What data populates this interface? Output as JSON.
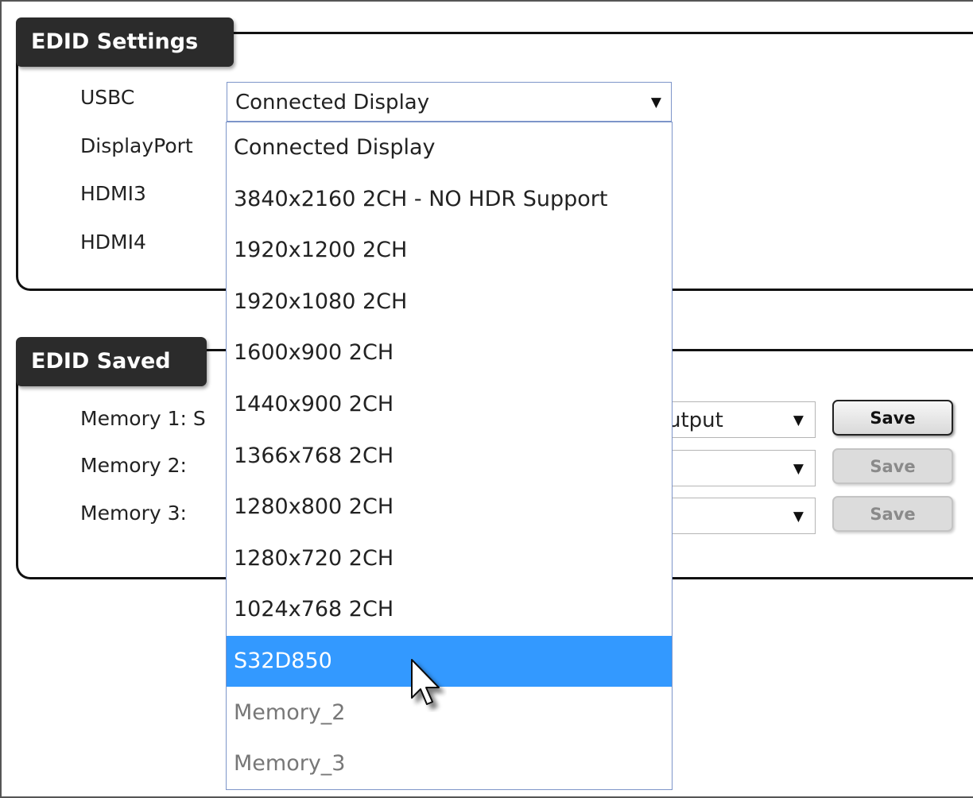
{
  "edid_settings": {
    "legend": "EDID Settings",
    "rows": [
      {
        "label": "USBC",
        "value": "Connected Display"
      },
      {
        "label": "DisplayPort"
      },
      {
        "label": "HDMI3"
      },
      {
        "label": "HDMI4"
      }
    ]
  },
  "edid_saved": {
    "legend": "EDID Saved",
    "rows": [
      {
        "label": "Memory 1: S",
        "value_tail": "utput",
        "button": "Save",
        "button_state": "enabled"
      },
      {
        "label": "Memory 2:",
        "value_tail": "",
        "button": "Save",
        "button_state": "disabled"
      },
      {
        "label": "Memory 3:",
        "value_tail": "",
        "button": "Save",
        "button_state": "disabled"
      }
    ]
  },
  "dropdown": {
    "options": [
      {
        "label": "Connected Display",
        "state": "normal"
      },
      {
        "label": "3840x2160 2CH - NO HDR Support",
        "state": "normal"
      },
      {
        "label": "1920x1200 2CH",
        "state": "normal"
      },
      {
        "label": "1920x1080 2CH",
        "state": "normal"
      },
      {
        "label": "1600x900 2CH",
        "state": "normal"
      },
      {
        "label": "1440x900 2CH",
        "state": "normal"
      },
      {
        "label": "1366x768 2CH",
        "state": "normal"
      },
      {
        "label": "1280x800 2CH",
        "state": "normal"
      },
      {
        "label": "1280x720 2CH",
        "state": "normal"
      },
      {
        "label": "1024x768 2CH",
        "state": "normal"
      },
      {
        "label": "S32D850",
        "state": "selected"
      },
      {
        "label": "Memory_2",
        "state": "disabled"
      },
      {
        "label": "Memory_3",
        "state": "disabled"
      }
    ]
  },
  "icons": {
    "caret": "▼",
    "cursor": "arrow-cursor-icon"
  },
  "colors": {
    "highlight": "#3399ff",
    "legend_bg": "#2b2b2b"
  }
}
